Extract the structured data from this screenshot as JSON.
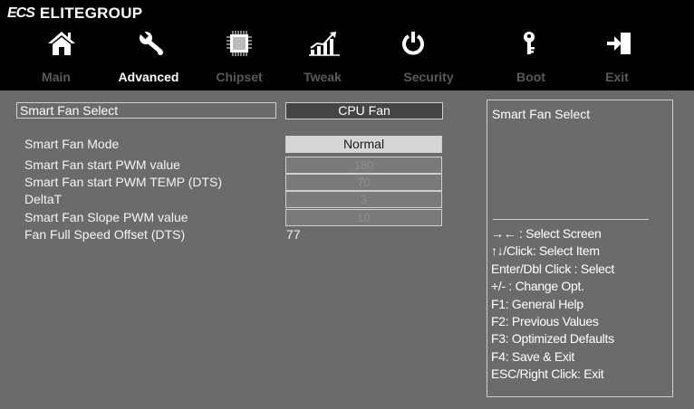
{
  "header": {
    "brand_logo": "ECS",
    "brand_name": "ELITEGROUP",
    "icons": [
      "home-icon",
      "wrench-icon",
      "chip-icon",
      "chart-icon",
      "power-icon",
      "key-icon",
      "exit-icon"
    ],
    "tabs": [
      "Main",
      "Advanced",
      "Chipset",
      "Tweak",
      "Security",
      "Boot",
      "Exit"
    ],
    "active_tab": "Advanced"
  },
  "settings": {
    "smart_fan_select": {
      "label": "Smart Fan Select",
      "value": "CPU Fan"
    },
    "smart_fan_mode": {
      "label": "Smart Fan Mode",
      "value": "Normal"
    },
    "start_pwm": {
      "label": "Smart  Fan start PWM value",
      "value": "180"
    },
    "start_pwm_temp": {
      "label": "Smart Fan start PWM TEMP (DTS)",
      "value": "70"
    },
    "delta_t": {
      "label": "DeltaT",
      "value": "3"
    },
    "slope_pwm": {
      "label": "Smart Fan Slope PWM value",
      "value": "10"
    },
    "full_speed_offset": {
      "label": "Fan Full Speed Offset (DTS)",
      "value": "77"
    }
  },
  "help": {
    "title": "Smart Fan Select",
    "keys": [
      "→←  : Select Screen",
      "↑↓/Click: Select Item",
      "Enter/Dbl Click : Select",
      "+/- : Change Opt.",
      "F1: General Help",
      "F2: Previous Values",
      "F3: Optimized Defaults",
      "F4: Save & Exit",
      "ESC/Right Click: Exit"
    ]
  },
  "colors": {
    "background": "#6b6b6b",
    "header": "#000000",
    "active_tab": "#ffffff",
    "inactive_tab": "#5a5a5a",
    "selected_value": "#454545"
  }
}
